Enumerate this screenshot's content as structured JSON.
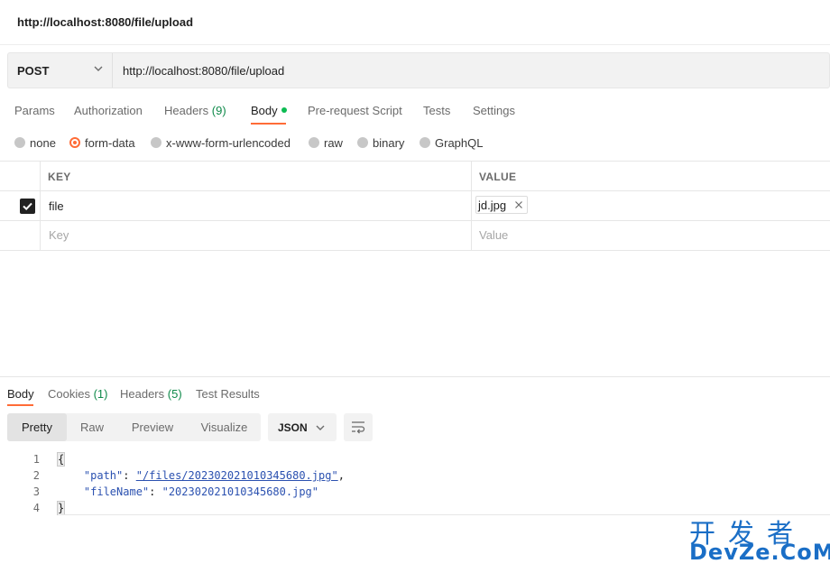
{
  "window": {
    "title": "http://localhost:8080/file/upload"
  },
  "request": {
    "method": "POST",
    "url": "http://localhost:8080/file/upload"
  },
  "request_tabs": [
    {
      "label": "Params",
      "count": ""
    },
    {
      "label": "Authorization",
      "count": ""
    },
    {
      "label": "Headers",
      "count": "(9)"
    },
    {
      "label": "Body",
      "count": ""
    },
    {
      "label": "Pre-request Script",
      "count": ""
    },
    {
      "label": "Tests",
      "count": ""
    },
    {
      "label": "Settings",
      "count": ""
    }
  ],
  "active_request_tab": "Body",
  "body_types": [
    {
      "label": "none"
    },
    {
      "label": "form-data"
    },
    {
      "label": "x-www-form-urlencoded"
    },
    {
      "label": "raw"
    },
    {
      "label": "binary"
    },
    {
      "label": "GraphQL"
    }
  ],
  "selected_body_type": "form-data",
  "form_table": {
    "headers": {
      "key": "KEY",
      "value": "VALUE"
    },
    "rows": [
      {
        "key": "file",
        "value": "jd.jpg",
        "checked": true
      }
    ],
    "placeholder": {
      "key": "Key",
      "value": "Value"
    }
  },
  "response_tabs": [
    {
      "label": "Body",
      "count": ""
    },
    {
      "label": "Cookies",
      "count": "(1)"
    },
    {
      "label": "Headers",
      "count": "(5)"
    },
    {
      "label": "Test Results",
      "count": ""
    }
  ],
  "view_modes": [
    "Pretty",
    "Raw",
    "Preview",
    "Visualize"
  ],
  "active_view_mode": "Pretty",
  "language": "JSON",
  "response_code": {
    "line_numbers": [
      "1",
      "2",
      "3",
      "4"
    ],
    "open_brace": "{",
    "close_brace": "}",
    "path_key": "\"path\"",
    "path_value": "\"/files/202302021010345680.jpg\"",
    "filename_key": "\"fileName\"",
    "filename_value": "\"202302021010345680.jpg\""
  },
  "watermark": {
    "line1": "开发者",
    "line2": "DevZe.CoM"
  },
  "colors": {
    "accent": "#ff6c37",
    "count": "#0f8a4a",
    "code": "#2b51b0",
    "watermark": "#1a6ec6"
  }
}
